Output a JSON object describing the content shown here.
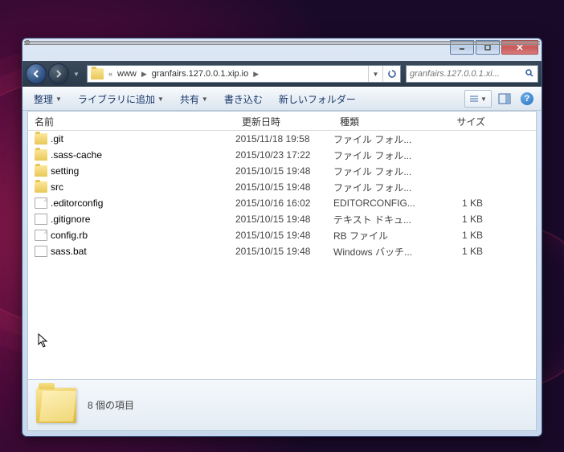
{
  "breadcrumb": {
    "prefix": "«",
    "parts": [
      "www",
      "granfairs.127.0.0.1.xip.io"
    ]
  },
  "search": {
    "placeholder": "granfairs.127.0.0.1.xi..."
  },
  "toolbar": {
    "organize": "整理",
    "library": "ライブラリに追加",
    "share": "共有",
    "burn": "書き込む",
    "newfolder": "新しいフォルダー"
  },
  "columns": {
    "name": "名前",
    "date": "更新日時",
    "type": "種類",
    "size": "サイズ"
  },
  "files": [
    {
      "icon": "folder",
      "name": ".git",
      "date": "2015/11/18 19:58",
      "type": "ファイル フォル...",
      "size": ""
    },
    {
      "icon": "folder",
      "name": ".sass-cache",
      "date": "2015/10/23 17:22",
      "type": "ファイル フォル...",
      "size": ""
    },
    {
      "icon": "folder",
      "name": "setting",
      "date": "2015/10/15 19:48",
      "type": "ファイル フォル...",
      "size": ""
    },
    {
      "icon": "folder",
      "name": "src",
      "date": "2015/10/15 19:48",
      "type": "ファイル フォル...",
      "size": ""
    },
    {
      "icon": "file",
      "name": ".editorconfig",
      "date": "2015/10/16 16:02",
      "type": "EDITORCONFIG...",
      "size": "1 KB"
    },
    {
      "icon": "text",
      "name": ".gitignore",
      "date": "2015/10/15 19:48",
      "type": "テキスト ドキュ...",
      "size": "1 KB"
    },
    {
      "icon": "file",
      "name": "config.rb",
      "date": "2015/10/15 19:48",
      "type": "RB ファイル",
      "size": "1 KB"
    },
    {
      "icon": "bat",
      "name": "sass.bat",
      "date": "2015/10/15 19:48",
      "type": "Windows バッチ...",
      "size": "1 KB"
    }
  ],
  "status": {
    "count": "8 個の項目"
  }
}
